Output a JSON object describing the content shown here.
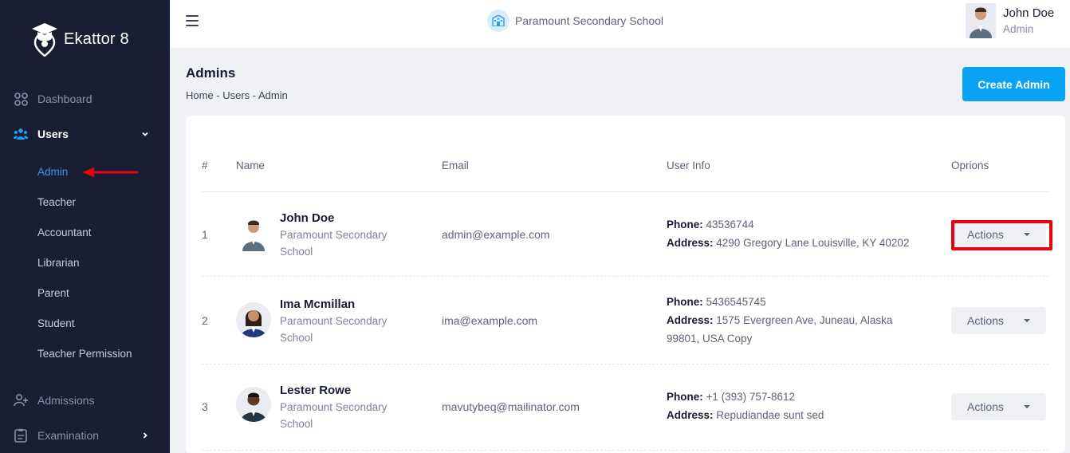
{
  "app": {
    "brand": "Ekattor 8"
  },
  "topbar": {
    "school_name": "Paramount Secondary School",
    "user_name": "John Doe",
    "user_role": "Admin"
  },
  "sidebar": {
    "items": [
      {
        "label": "Dashboard",
        "icon": "dashboard-icon"
      },
      {
        "label": "Users",
        "icon": "users-icon",
        "active": true
      },
      {
        "label": "Admissions",
        "icon": "add-user-icon"
      },
      {
        "label": "Examination",
        "icon": "exam-icon"
      }
    ],
    "sub_items": [
      {
        "label": "Admin",
        "current": true
      },
      {
        "label": "Teacher"
      },
      {
        "label": "Accountant"
      },
      {
        "label": "Librarian"
      },
      {
        "label": "Parent"
      },
      {
        "label": "Student"
      },
      {
        "label": "Teacher Permission"
      }
    ]
  },
  "page": {
    "title": "Admins",
    "breadcrumb": "Home - Users - Admin",
    "create_button": "Create Admin"
  },
  "table": {
    "columns": [
      "#",
      "Name",
      "Email",
      "User Info",
      "Oprions"
    ],
    "phone_label": "Phone:",
    "address_label": "Address:",
    "actions_label": "Actions",
    "rows": [
      {
        "num": "1",
        "name": "John Doe",
        "school": "Paramount Secondary School",
        "email": "admin@example.com",
        "phone": "43536744",
        "address": "4290 Gregory Lane Louisville, KY 40202"
      },
      {
        "num": "2",
        "name": "Ima Mcmillan",
        "school": "Paramount Secondary School",
        "email": "ima@example.com",
        "phone": "5436545745",
        "address": "1575 Evergreen Ave, Juneau, Alaska 99801, USA Copy"
      },
      {
        "num": "3",
        "name": "Lester Rowe",
        "school": "Paramount Secondary School",
        "email": "mavutybeq@mailinator.com",
        "phone": "+1 (393) 757-8612",
        "address": "Repudiandae sunt sed"
      }
    ]
  },
  "colors": {
    "sidebar_bg": "#1a1e35",
    "accent": "#0aa2f4",
    "highlight": "#e8000e"
  }
}
